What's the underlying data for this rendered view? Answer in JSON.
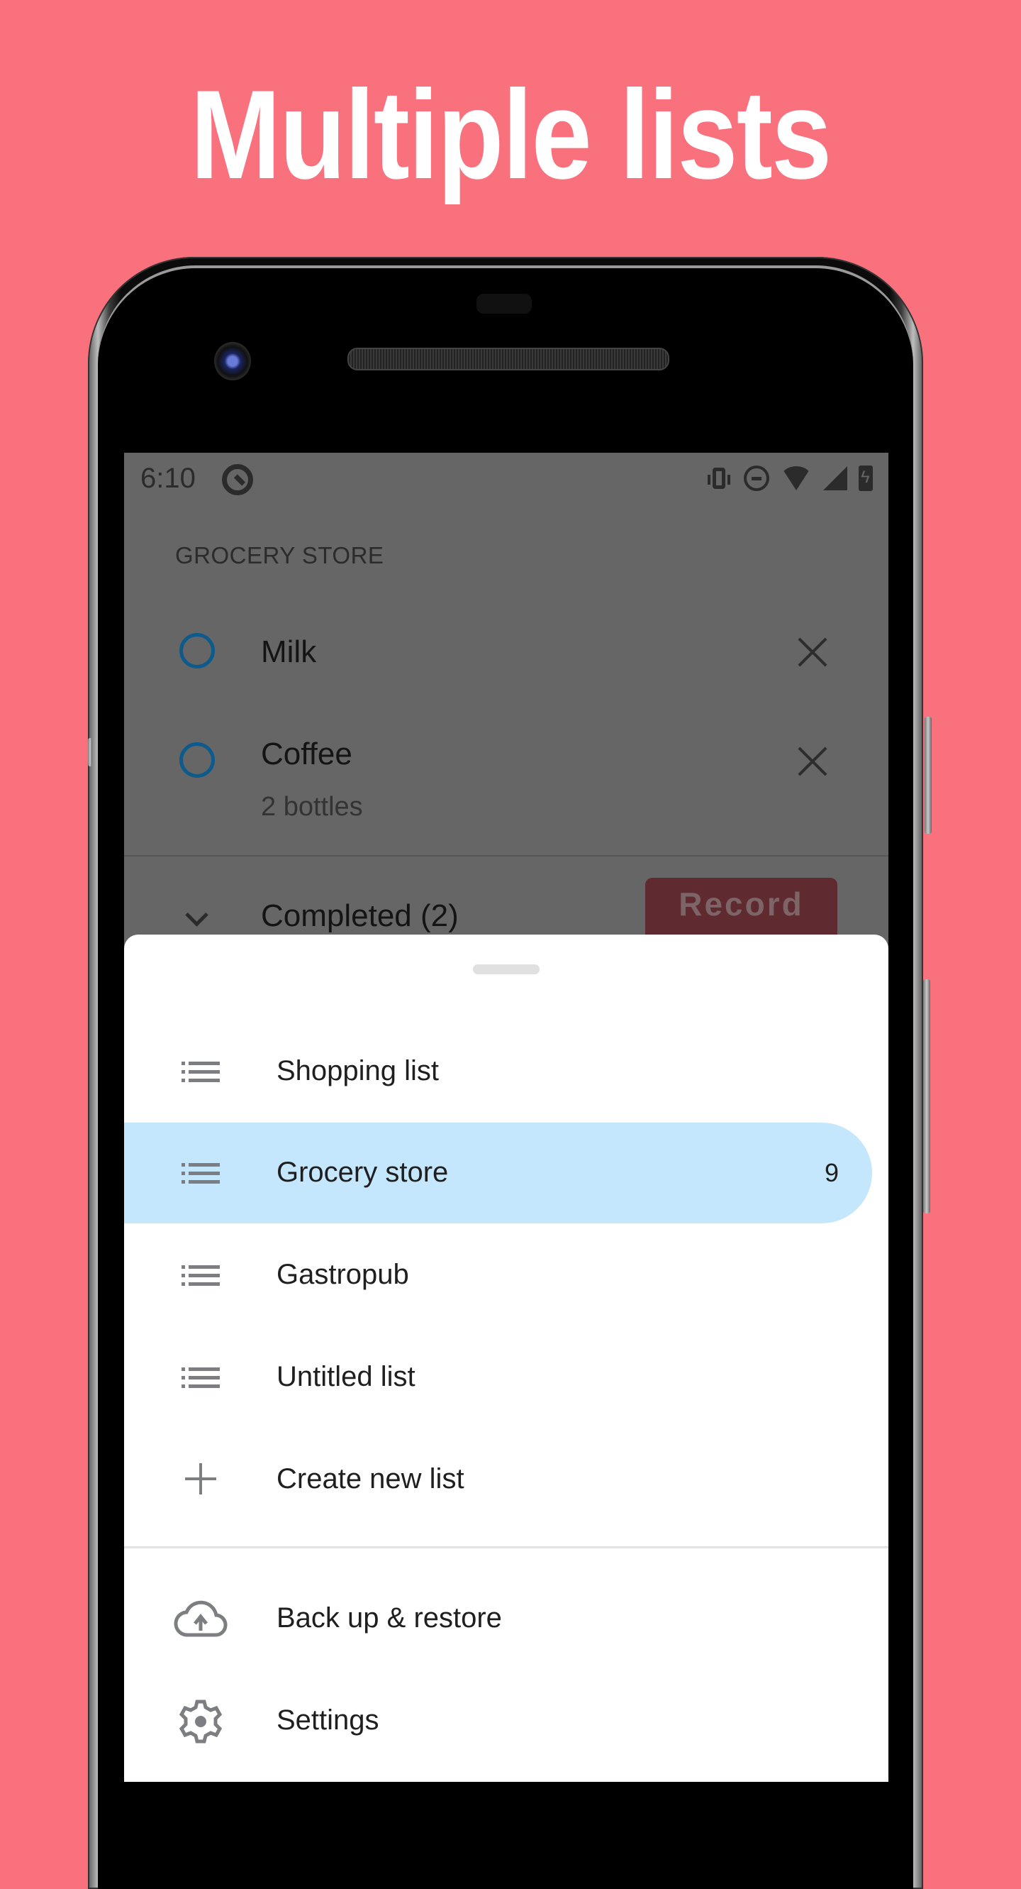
{
  "headline": "Multiple lists",
  "colors": {
    "background": "#fa717e",
    "scrim": "#666666",
    "checkbox": "#0d5a8c",
    "active_item": "#c5e7fd",
    "record_button": "#5f2a30",
    "icon_gray": "#7d7e82"
  },
  "status_bar": {
    "time": "6:10",
    "icons": [
      "q-logo-icon",
      "vibrate-icon",
      "do-not-disturb-icon",
      "wifi-icon",
      "signal-icon",
      "battery-charging-icon"
    ]
  },
  "list_screen": {
    "section_title": "GROCERY STORE",
    "items": [
      {
        "name": "Milk",
        "note": ""
      },
      {
        "name": "Coffee",
        "note": "2 bottles"
      }
    ],
    "completed_label": "Completed (2)",
    "record_button": "Record"
  },
  "sheet": {
    "lists": [
      {
        "label": "Shopping list",
        "icon": "list-icon",
        "count": "",
        "active": false
      },
      {
        "label": "Grocery store",
        "icon": "list-icon",
        "count": "9",
        "active": true
      },
      {
        "label": "Gastropub",
        "icon": "list-icon",
        "count": "",
        "active": false
      },
      {
        "label": "Untitled list",
        "icon": "list-icon",
        "count": "",
        "active": false
      }
    ],
    "create_label": "Create new list",
    "backup_label": "Back up & restore",
    "settings_label": "Settings"
  }
}
